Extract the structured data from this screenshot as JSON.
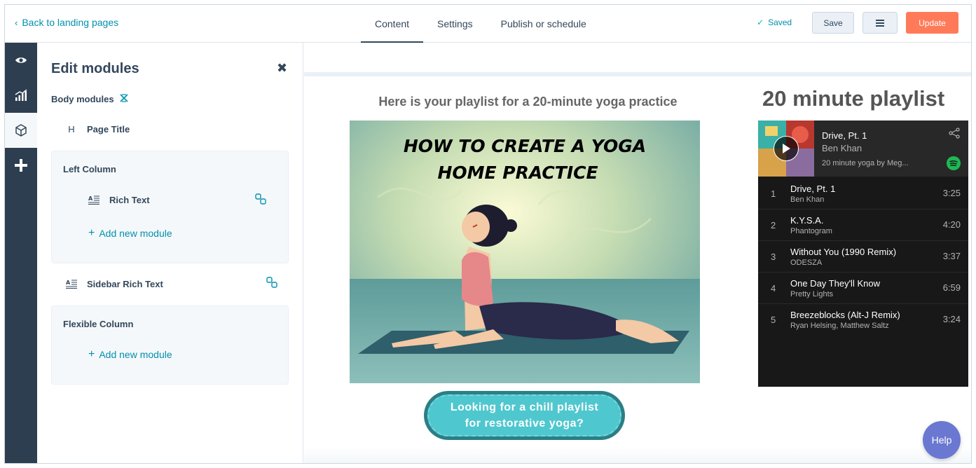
{
  "header": {
    "back_link": "Back to landing pages",
    "tabs": [
      {
        "label": "Content",
        "active": true
      },
      {
        "label": "Settings",
        "active": false
      },
      {
        "label": "Publish or schedule",
        "active": false
      }
    ],
    "saved_status": "Saved",
    "save_label": "Save",
    "update_label": "Update"
  },
  "rail": {
    "items": [
      {
        "icon": "eye-icon"
      },
      {
        "icon": "analytics-icon"
      },
      {
        "icon": "cube-icon",
        "active": true
      },
      {
        "icon": "plus-icon"
      }
    ]
  },
  "panel": {
    "title": "Edit modules",
    "section_label": "Body modules",
    "page_title_module": "Page Title",
    "left_column": {
      "title": "Left Column",
      "module": "Rich Text",
      "add_label": "Add new module"
    },
    "sidebar_module": "Sidebar Rich Text",
    "flexible_column": {
      "title": "Flexible Column",
      "add_label": "Add new module"
    }
  },
  "preview": {
    "headline": "Here is your playlist for a 20-minute yoga practice",
    "image_text_line1": "HOW TO CREATE A YOGA",
    "image_text_line2": "HOME PRACTICE",
    "cta_line1": "Looking for a chill playlist",
    "cta_line2": "for restorative yoga?",
    "playlist_title": "20 minute playlist",
    "spotify": {
      "now_playing_title": "Drive, Pt. 1",
      "now_playing_artist": "Ben Khan",
      "playlist_name": "20 minute yoga by Meg...",
      "tracks": [
        {
          "num": "1",
          "name": "Drive, Pt. 1",
          "artist": "Ben Khan",
          "duration": "3:25"
        },
        {
          "num": "2",
          "name": "K.Y.S.A.",
          "artist": "Phantogram",
          "duration": "4:20"
        },
        {
          "num": "3",
          "name": "Without You (1990 Remix)",
          "artist": "ODESZA",
          "duration": "3:37"
        },
        {
          "num": "4",
          "name": "One Day They'll Know",
          "artist": "Pretty Lights",
          "duration": "6:59"
        },
        {
          "num": "5",
          "name": "Breezeblocks (Alt-J Remix)",
          "artist": "Ryan Helsing, Matthew Saltz",
          "duration": "3:24"
        }
      ]
    }
  },
  "help_label": "Help",
  "colors": {
    "accent": "#0091ae",
    "update": "#ff7a59",
    "rail": "#2d3e50",
    "spotify_green": "#1db954",
    "help": "#6a78d1"
  }
}
